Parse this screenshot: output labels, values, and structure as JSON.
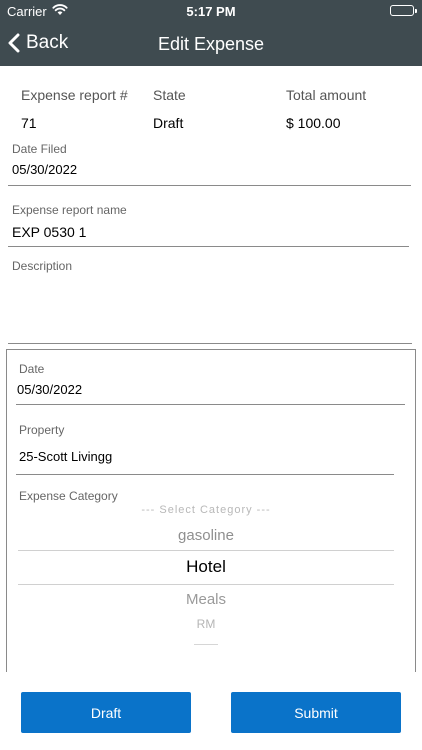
{
  "status_bar": {
    "carrier": "Carrier",
    "time": "5:17 PM"
  },
  "nav": {
    "back_label": "Back",
    "title": "Edit Expense"
  },
  "summary": {
    "report_number_label": "Expense report #",
    "report_number": "71",
    "state_label": "State",
    "state": "Draft",
    "total_label": "Total amount",
    "total": "$ 100.00"
  },
  "form": {
    "date_filed_label": "Date Filed",
    "date_filed": "05/30/2022",
    "report_name_label": "Expense report name",
    "report_name": "EXP 0530 1",
    "description_label": "Description",
    "description": ""
  },
  "line": {
    "date_label": "Date",
    "date": "05/30/2022",
    "property_label": "Property",
    "property": "25-Scott Livingg",
    "category_label": "Expense Category",
    "category_options": [
      "--- Select Category ---",
      "gasoline",
      "Hotel",
      "Meals",
      "RM",
      ""
    ],
    "selected_category": "Hotel"
  },
  "actions": {
    "draft_label": "Draft",
    "submit_label": "Submit"
  },
  "colors": {
    "nav_bg": "#3f4b50",
    "button_bg": "#0a73c9"
  }
}
